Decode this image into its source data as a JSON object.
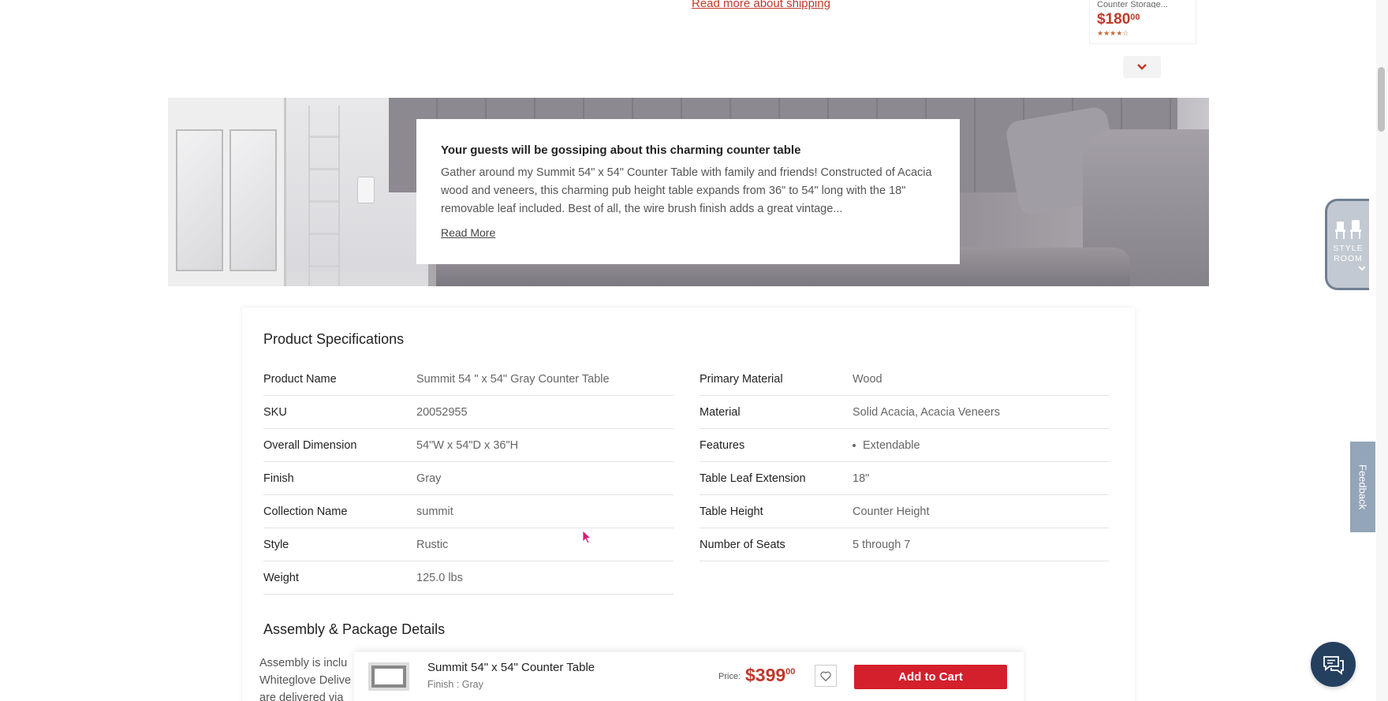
{
  "shipping": {
    "link_text": "Read more about shipping"
  },
  "recommendation": {
    "name": "Counter Storage...",
    "price_dollars": "$180",
    "price_cents": "00",
    "rating_stars": "★★★★☆"
  },
  "banner": {
    "title": "Your guests will be gossiping about this charming counter table",
    "description": "Gather around my Summit 54\" x 54\" Counter Table with family and friends! Constructed of Acacia wood and veneers, this charming pub height table expands from 36\" to 54\" long with the 18\" removable leaf included. Best of all, the wire brush finish adds a great vintage...",
    "read_more": "Read More"
  },
  "specs": {
    "heading": "Product Specifications",
    "left": [
      {
        "label": "Product Name",
        "value": "Summit 54 \" x 54\" Gray Counter Table"
      },
      {
        "label": "SKU",
        "value": "20052955"
      },
      {
        "label": "Overall Dimension",
        "value": "54\"W x 54\"D x 36\"H"
      },
      {
        "label": "Finish",
        "value": "Gray"
      },
      {
        "label": "Collection Name",
        "value": "summit"
      },
      {
        "label": "Style",
        "value": "Rustic"
      },
      {
        "label": "Weight",
        "value": "125.0 lbs"
      }
    ],
    "right": [
      {
        "label": "Primary Material",
        "value": "Wood"
      },
      {
        "label": "Material",
        "value": "Solid Acacia, Acacia Veneers"
      },
      {
        "label": "Features",
        "value": "Extendable"
      },
      {
        "label": "Table Leaf Extension",
        "value": "18\""
      },
      {
        "label": "Table Height",
        "value": "Counter Height"
      },
      {
        "label": "Number of Seats",
        "value": "5 through 7"
      }
    ]
  },
  "assembly": {
    "heading": "Assembly & Package Details",
    "text_line1": "Assembly is inclu",
    "text_line2": "Whiteglove Delive",
    "text_line3": "are delivered via"
  },
  "sticky": {
    "product_name": "Summit 54\" x 54\" Counter Table",
    "finish": "Finish : Gray",
    "price_label": "Price:",
    "price_dollars": "$399",
    "price_cents": "00",
    "cart_label": "Add to Cart"
  },
  "widgets": {
    "style_room_line1": "STYLE",
    "style_room_line2": "ROOM",
    "feedback": "Feedback"
  },
  "colors": {
    "accent_red": "#d41f2c",
    "price_red": "#c0392b",
    "chat_navy": "#25405f"
  }
}
